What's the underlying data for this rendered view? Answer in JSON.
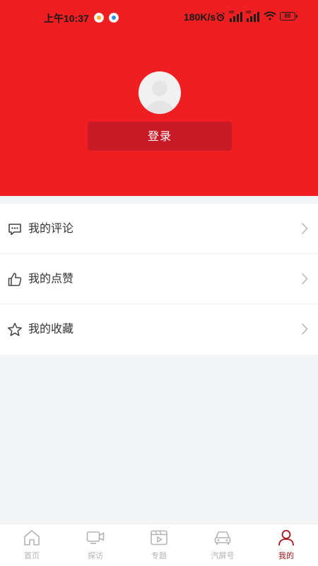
{
  "status_bar": {
    "time": "上午10:37",
    "network_speed": "180K/s",
    "battery": "86"
  },
  "profile": {
    "login_label": "登录"
  },
  "menu": {
    "items": [
      {
        "label": "我的评论",
        "icon": "comment-icon"
      },
      {
        "label": "我的点赞",
        "icon": "thumbs-up-icon"
      },
      {
        "label": "我的收藏",
        "icon": "star-icon"
      }
    ]
  },
  "tab_bar": {
    "tabs": [
      {
        "label": "首页",
        "icon": "home-icon",
        "active": false
      },
      {
        "label": "探访",
        "icon": "video-camera-icon",
        "active": false
      },
      {
        "label": "专题",
        "icon": "film-icon",
        "active": false
      },
      {
        "label": "汽屏号",
        "icon": "car-icon",
        "active": false
      },
      {
        "label": "我的",
        "icon": "user-icon",
        "active": true
      }
    ]
  },
  "colors": {
    "header_red": "#ef1f21",
    "login_button": "#c81a26",
    "active_tab": "#a5141b",
    "inactive_tab": "#b3b3b3"
  }
}
